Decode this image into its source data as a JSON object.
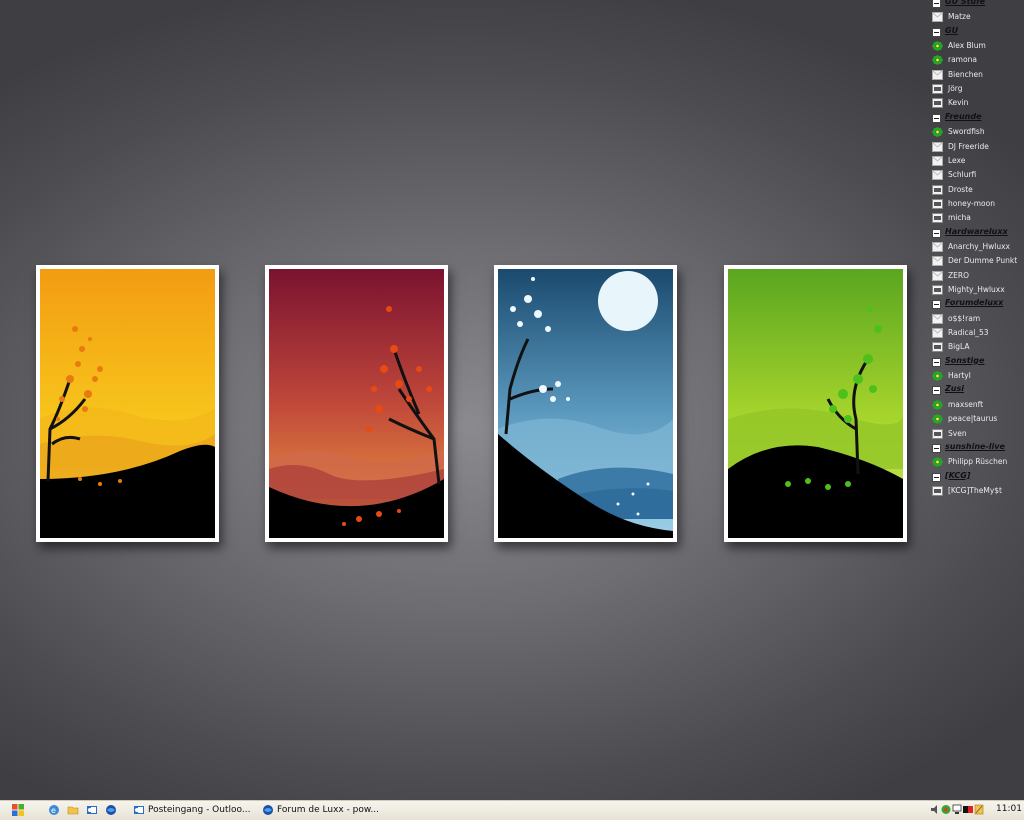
{
  "buddy_list": {
    "rows": [
      {
        "type": "group",
        "name": "GU Stufe"
      },
      {
        "type": "contact",
        "name": "Matze",
        "status": "message"
      },
      {
        "type": "group",
        "name": "GU"
      },
      {
        "type": "contact",
        "name": "Alex Blum",
        "status": "online"
      },
      {
        "type": "contact",
        "name": "ramona",
        "status": "online"
      },
      {
        "type": "contact",
        "name": "Bienchen",
        "status": "message"
      },
      {
        "type": "contact",
        "name": "Jörg",
        "status": "na"
      },
      {
        "type": "contact",
        "name": "Kevin",
        "status": "na"
      },
      {
        "type": "group",
        "name": "Freunde"
      },
      {
        "type": "contact",
        "name": "Swordfish",
        "status": "online"
      },
      {
        "type": "contact",
        "name": "DJ Freeride",
        "status": "message"
      },
      {
        "type": "contact",
        "name": "Lexe",
        "status": "message"
      },
      {
        "type": "contact",
        "name": "Schlurfi",
        "status": "message"
      },
      {
        "type": "contact",
        "name": "Droste",
        "status": "na"
      },
      {
        "type": "contact",
        "name": "honey-moon",
        "status": "na"
      },
      {
        "type": "contact",
        "name": "micha",
        "status": "na"
      },
      {
        "type": "group",
        "name": "Hardwareluxx"
      },
      {
        "type": "contact",
        "name": "Anarchy_Hwluxx",
        "status": "message"
      },
      {
        "type": "contact",
        "name": "Der Dumme Punkt",
        "status": "message"
      },
      {
        "type": "contact",
        "name": "ZERO",
        "status": "message"
      },
      {
        "type": "contact",
        "name": "Mighty_Hwluxx",
        "status": "na"
      },
      {
        "type": "group",
        "name": "Forumdeluxx"
      },
      {
        "type": "contact",
        "name": "o$$!ram",
        "status": "message"
      },
      {
        "type": "contact",
        "name": "Radical_53",
        "status": "message"
      },
      {
        "type": "contact",
        "name": "BigLA",
        "status": "na"
      },
      {
        "type": "group",
        "name": "Sonstige"
      },
      {
        "type": "contact",
        "name": "Hartyl",
        "status": "online"
      },
      {
        "type": "group",
        "name": "Zusi"
      },
      {
        "type": "contact",
        "name": "maxsenft",
        "status": "online"
      },
      {
        "type": "contact",
        "name": "peace|taurus",
        "status": "online"
      },
      {
        "type": "contact",
        "name": "Sven",
        "status": "na"
      },
      {
        "type": "group",
        "name": "sunshine-live"
      },
      {
        "type": "contact",
        "name": "Philipp Rüschen",
        "status": "online"
      },
      {
        "type": "group",
        "name": "[KCG]"
      },
      {
        "type": "contact",
        "name": "[KCG]TheMy$t",
        "status": "na"
      }
    ]
  },
  "taskbar": {
    "start_icon": "windows-flag-icon",
    "quick_launch": [
      "internet-explorer-icon",
      "folder-icon",
      "outlook-icon",
      "browser-globe-icon"
    ],
    "tasks": [
      {
        "label": "Posteingang - Outloo...",
        "icon": "outlook-icon"
      },
      {
        "label": "Forum de Luxx - pow...",
        "icon": "browser-globe-icon"
      }
    ],
    "clock": "11:01"
  },
  "wallpaper": {
    "cards": [
      "autumn-yellow",
      "autumn-red",
      "winter-blue",
      "spring-green"
    ]
  },
  "colors": {
    "online": "#22aa22",
    "group_text": "#111111",
    "taskbar_bg": "#ece9d8"
  }
}
